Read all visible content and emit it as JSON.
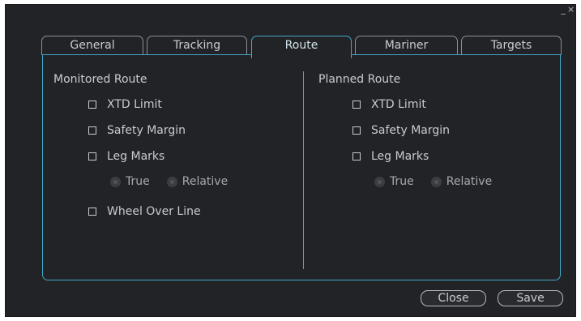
{
  "window_controls": [
    "_",
    "×"
  ],
  "tabs": [
    {
      "label": "General",
      "active": false
    },
    {
      "label": "Tracking",
      "active": false
    },
    {
      "label": "Route",
      "active": true
    },
    {
      "label": "Mariner",
      "active": false
    },
    {
      "label": "Targets",
      "active": false
    }
  ],
  "monitored": {
    "title": "Monitored Route",
    "xtd_limit": "XTD Limit",
    "safety_margin": "Safety Margin",
    "leg_marks": "Leg Marks",
    "radio_true": "True",
    "radio_relative": "Relative",
    "wheel_over_line": "Wheel Over Line"
  },
  "planned": {
    "title": "Planned Route",
    "xtd_limit": "XTD Limit",
    "safety_margin": "Safety Margin",
    "leg_marks": "Leg Marks",
    "radio_true": "True",
    "radio_relative": "Relative"
  },
  "buttons": {
    "close": "Close",
    "save": "Save"
  },
  "colors": {
    "background": "#222326",
    "accent": "#3fa9c9",
    "text": "#c9cbcf"
  }
}
